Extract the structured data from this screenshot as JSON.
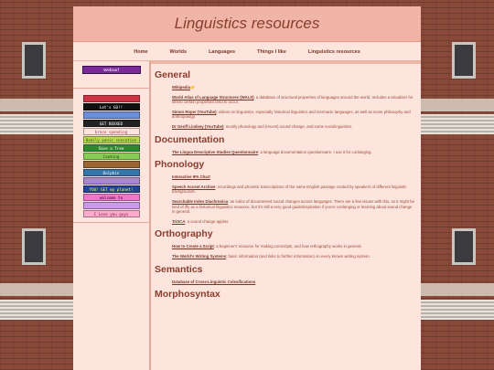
{
  "site": {
    "title": "Linguistics resources"
  },
  "nav": [
    {
      "label": "Home"
    },
    {
      "label": "Worlds"
    },
    {
      "label": "Languages"
    },
    {
      "label": "Things I like"
    },
    {
      "label": "Linguistics resources"
    }
  ],
  "sidebar": {
    "top_button": "Websurf",
    "badges": [
      {
        "text": "",
        "bg": "#cc3344",
        "fg": "#fff"
      },
      {
        "text": "Let's GO!!",
        "bg": "#111111",
        "fg": "#ffffff"
      },
      {
        "text": "",
        "bg": "#6a8fd8",
        "fg": "#fff"
      },
      {
        "text": "GET BOXXED",
        "bg": "#222222",
        "fg": "#ffffff"
      },
      {
        "text": "brace spending",
        "bg": "#fde4dd",
        "fg": "#aa3355"
      },
      {
        "text": "Bodily panic sensation",
        "bg": "#b9d94a",
        "fg": "#225522"
      },
      {
        "text": "Save a Tree",
        "bg": "#2f8a2f",
        "fg": "#ffffff"
      },
      {
        "text": "Cooking",
        "bg": "#88cc55",
        "fg": "#224411"
      },
      {
        "text": "",
        "bg": "#996633",
        "fg": "#fff"
      },
      {
        "text": "Dolphin",
        "bg": "#3377aa",
        "fg": "#ffffff"
      },
      {
        "text": "",
        "bg": "#aa88cc",
        "fg": "#fff"
      },
      {
        "text": "YOU! GET my planet!",
        "bg": "#224499",
        "fg": "#ffff55"
      },
      {
        "text": "welcome to",
        "bg": "#ee77cc",
        "fg": "#330033"
      },
      {
        "text": "",
        "bg": "#cc99ee",
        "fg": "#fff"
      },
      {
        "text": "I Love you guys",
        "bg": "#ffaacc",
        "fg": "#7a2050"
      }
    ]
  },
  "sections": [
    {
      "heading": "General",
      "entries": [
        {
          "title": "Wikipedia",
          "desc": "👉"
        },
        {
          "title": "World Atlas of Language Structures (WALS)",
          "desc": ": a database of structural properties of languages around the world. Includes a visualiser for where certain properties tend to occur."
        },
        {
          "title": "Simon Roper (YouTube)",
          "desc": ": videos on linguistics, especially historical linguistics and Germanic languages, as well as some philosophy and anthropology."
        },
        {
          "title": "Dr Geoff Lindsey (YouTube)",
          "desc": ": mostly phonology and (recent) sound change, and some sociolinguistics."
        }
      ]
    },
    {
      "heading": "Documentation",
      "entries": [
        {
          "title": "The Lingua Descriptive Studies Questionnaire",
          "desc": ": a language documentation questionnaire. I use it for conlanging."
        }
      ]
    },
    {
      "heading": "Phonology",
      "entries": [
        {
          "title": "Interactive IPA Chart",
          "desc": ""
        },
        {
          "title": "Speech Accent Archive",
          "desc": ": recordings and phonetic transcriptions of the same English passage recited by speakers of different linguistic backgrounds."
        },
        {
          "title": "Searchable Index Diachronica",
          "desc": ": an index of documented sound changes across languages. There are a few issues with this, so it might be kind of iffy as a historical linguistics resource, but it's still a very good guide/inspiration if you're conlanging or learning about sound change in general."
        },
        {
          "title": "TriSCA",
          "desc": ": a sound change applier."
        }
      ]
    },
    {
      "heading": "Orthography",
      "entries": [
        {
          "title": "How to Create a Script",
          "desc": ": a beginner's resource for making conscripts, and how orthography works in general."
        },
        {
          "title": "The World's Writing Systems",
          "desc": ": basic information (and links to further information) on every known writing system."
        }
      ]
    },
    {
      "heading": "Semantics",
      "entries": [
        {
          "title": "Database of Cross-Linguistic Colexifications",
          "desc": ""
        }
      ]
    },
    {
      "heading": "Morphosyntax",
      "entries": []
    }
  ]
}
